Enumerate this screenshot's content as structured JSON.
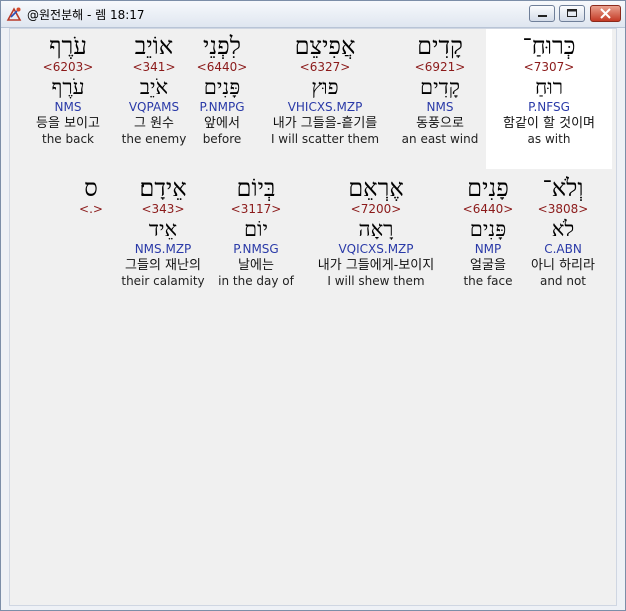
{
  "window": {
    "title": "@원전분해 - 렘 18:17"
  },
  "rows": [
    [
      {
        "heb": "כְּרוּחַ־",
        "strong": "<7307>",
        "root": "רוּחַ",
        "morph": "P.NFSG",
        "kor": "함같이 할 것이며",
        "eng": "as with",
        "highlight": true
      },
      {
        "heb": "קָדִים",
        "strong": "<6921>",
        "root": "קָדִים",
        "morph": "NMS",
        "kor": "동풍으로",
        "eng": "an east wind",
        "highlight": false
      },
      {
        "heb": "אֲפִיצֵם",
        "strong": "<6327>",
        "root": "פוּץ",
        "morph": "VHICXS.MZP",
        "kor": "내가 그들을-흩기를",
        "eng": "I will scatter them",
        "highlight": false
      },
      {
        "heb": "לִפְנֵי",
        "strong": "<6440>",
        "root": "פָּנִים",
        "morph": "P.NMPG",
        "kor": "앞에서",
        "eng": "before",
        "highlight": false
      },
      {
        "heb": "אוֹיֵב",
        "strong": "<341>",
        "root": "אֹיֵב",
        "morph": "VQPAMS",
        "kor": "그 원수",
        "eng": "the enemy",
        "highlight": false
      },
      {
        "heb": "עֹרֶף",
        "strong": "<6203>",
        "root": "עֹרֶף",
        "morph": "NMS",
        "kor": "등을 보이고",
        "eng": "the back",
        "highlight": false
      }
    ],
    [
      {
        "heb": "וְלֹא־",
        "strong": "<3808>",
        "root": "לֹא",
        "morph": "C.ABN",
        "kor": "아니 하리라",
        "eng": "and not",
        "highlight": false
      },
      {
        "heb": "פָנִים",
        "strong": "<6440>",
        "root": "פָּנִים",
        "morph": "NMP",
        "kor": "얼굴을",
        "eng": "the face",
        "highlight": false
      },
      {
        "heb": "אֶרְאֵם",
        "strong": "<7200>",
        "root": "רָאָה",
        "morph": "VQICXS.MZP",
        "kor": "내가 그들에게-보이지",
        "eng": "I will shew them",
        "highlight": false
      },
      {
        "heb": "בְּיוֹם",
        "strong": "<3117>",
        "root": "יוֹם",
        "morph": "P.NMSG",
        "kor": "날에는",
        "eng": "in the day of",
        "highlight": false
      },
      {
        "heb": "אֵידָם׃",
        "strong": "<343>",
        "root": "אֵיד",
        "morph": "NMS.MZP",
        "kor": "그들의 재난의",
        "eng": "their calamity",
        "highlight": false
      },
      {
        "heb": "ס",
        "strong": "<.>",
        "root": "",
        "morph": "",
        "kor": "",
        "eng": "",
        "highlight": false
      }
    ]
  ]
}
